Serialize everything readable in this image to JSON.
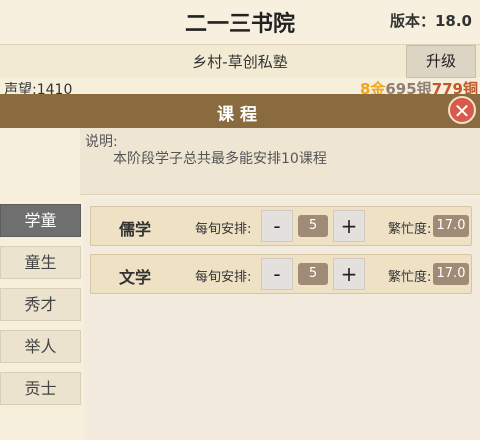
{
  "header": {
    "title": "二一三书院",
    "version": "版本：18.0"
  },
  "subbar": {
    "location": "乡村-草创私塾",
    "upgrade_label": "升级"
  },
  "stats": {
    "reputation": "声望:1410",
    "gold": "8金",
    "silver": "695银",
    "copper": "779铜",
    "colors": {
      "gold": "#f0a818",
      "silver": "#8f7f73",
      "copper": "#c0582a"
    }
  },
  "modal": {
    "title": "课程",
    "close_icon": "close-icon",
    "desc_label": "说明:",
    "desc_text": "本阶段学子总共最多能安排10课程"
  },
  "sidebar": {
    "items": [
      {
        "label": "学童",
        "active": true
      },
      {
        "label": "童生",
        "active": false
      },
      {
        "label": "秀才",
        "active": false
      },
      {
        "label": "举人",
        "active": false
      },
      {
        "label": "贡士",
        "active": false
      }
    ]
  },
  "courses": [
    {
      "name": "儒学",
      "schedule_label": "每旬安排:",
      "minus": "-",
      "count": "5",
      "plus": "+",
      "busy_label": "繁忙度:",
      "busy_value": "17.0"
    },
    {
      "name": "文学",
      "schedule_label": "每旬安排:",
      "minus": "-",
      "count": "5",
      "plus": "+",
      "busy_label": "繁忙度:",
      "busy_value": "17.0"
    }
  ]
}
